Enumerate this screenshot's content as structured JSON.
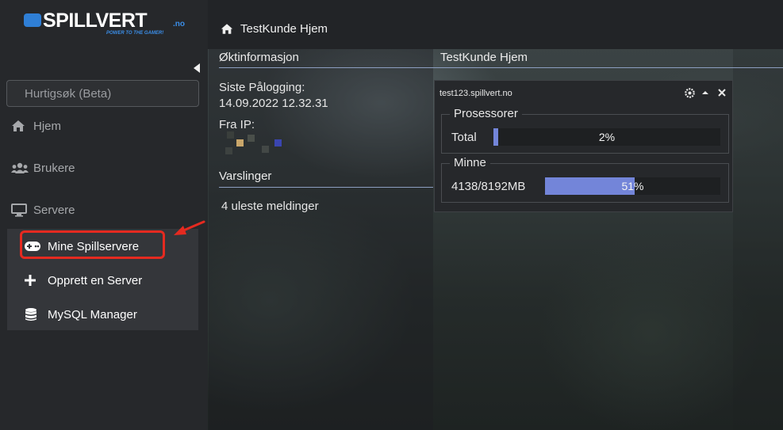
{
  "brand": {
    "name": "SPILLVERT",
    "tld": ".no",
    "tagline": "POWER TO THE GAMER!"
  },
  "search": {
    "placeholder": "Hurtigsøk (Beta)"
  },
  "sidebar": {
    "items": [
      {
        "label": "Hjem",
        "icon": "home-icon"
      },
      {
        "label": "Brukere",
        "icon": "users-icon"
      },
      {
        "label": "Servere",
        "icon": "monitor-icon"
      }
    ],
    "submenu": [
      {
        "label": "Mine Spillservere",
        "icon": "gamepad-icon"
      },
      {
        "label": "Opprett en Server",
        "icon": "plus-icon"
      },
      {
        "label": "MySQL Manager",
        "icon": "database-icon"
      }
    ]
  },
  "header": {
    "title": "TestKunde Hjem"
  },
  "session": {
    "title": "Øktinformasjon",
    "last_login_label": "Siste Pålogging:",
    "last_login_value": "14.09.2022 12.32.31",
    "ip_label": "Fra IP:"
  },
  "notifications": {
    "title": "Varslinger",
    "text": "4 uleste meldinger"
  },
  "home_panel": {
    "title": "TestKunde Hjem"
  },
  "server_widget": {
    "hostname": "test123.spillvert.no",
    "cpu": {
      "legend": "Prosessorer",
      "label": "Total",
      "percent_text": "2%",
      "percent": 2
    },
    "memory": {
      "legend": "Minne",
      "label": "4138/8192MB",
      "percent_text": "51%",
      "percent": 51
    }
  },
  "colors": {
    "accent": "#7385d9",
    "highlight": "#e52a20",
    "brand_blue": "#2f7fd6"
  }
}
